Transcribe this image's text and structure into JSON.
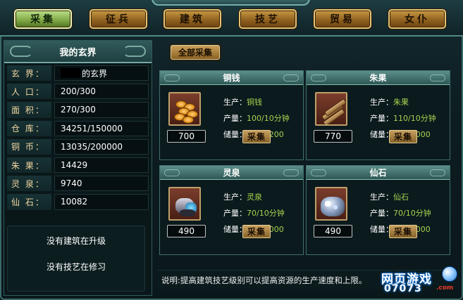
{
  "tabs": [
    "采集",
    "征兵",
    "建筑",
    "技艺",
    "贸易",
    "女仆"
  ],
  "left": {
    "title": "我的玄界",
    "rows": [
      {
        "label": "玄 界：",
        "value": "的玄界"
      },
      {
        "label": "人 口：",
        "value": "200/300"
      },
      {
        "label": "面 积：",
        "value": "270/300"
      },
      {
        "label": "仓 库：",
        "value": "34251/150000"
      },
      {
        "label": "铜 币：",
        "value": "13035/200000"
      },
      {
        "label": "朱 果：",
        "value": "14429"
      },
      {
        "label": "灵 泉：",
        "value": "9740"
      },
      {
        "label": "仙 石：",
        "value": "10082"
      }
    ],
    "notes": [
      "没有建筑在升级",
      "没有技艺在修习"
    ]
  },
  "collect_all": "全部采集",
  "labels": {
    "produce": "生产：",
    "output": "产量：",
    "stock": "储量：",
    "collect": "采集"
  },
  "cards": [
    {
      "title": "铜钱",
      "icon": "coins-icon",
      "produce": "铜钱",
      "output": "100/10分钟",
      "capacity": "700/7200",
      "stock": "700"
    },
    {
      "title": "朱果",
      "icon": "logs-icon",
      "produce": "朱果",
      "output": "110/10分钟",
      "capacity": "770/8000",
      "stock": "770"
    },
    {
      "title": "灵泉",
      "icon": "spring-icon",
      "produce": "灵泉",
      "output": "70/10分钟",
      "capacity": "490/4000",
      "stock": "490"
    },
    {
      "title": "仙石",
      "icon": "stone-icon",
      "produce": "仙石",
      "output": "70/10分钟",
      "capacity": "490/4000",
      "stock": "490"
    }
  ],
  "tip": "说明:提高建筑技艺级别可以提高资源的生产速度和上限。",
  "watermark": {
    "line1": "网页游戏",
    "line2": "07073",
    "suffix": ".com"
  }
}
